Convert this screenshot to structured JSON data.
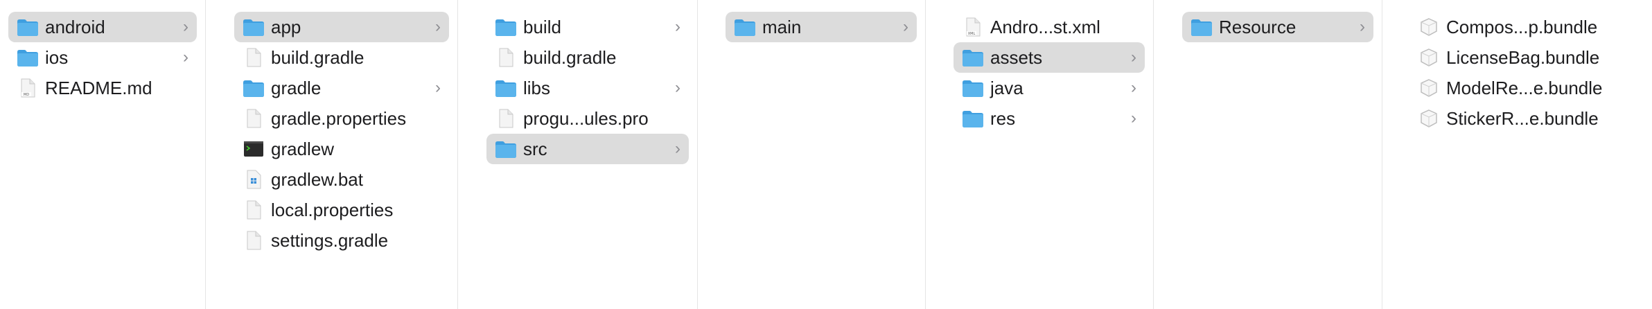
{
  "columns": [
    {
      "items": [
        {
          "name": "android",
          "icon": "folder-icon",
          "chevron": true,
          "selected": true
        },
        {
          "name": "ios",
          "icon": "folder-icon",
          "chevron": true,
          "selected": false
        },
        {
          "name": "README.md",
          "icon": "md-file-icon",
          "chevron": false,
          "selected": false
        }
      ]
    },
    {
      "items": [
        {
          "name": "app",
          "icon": "folder-icon",
          "chevron": true,
          "selected": true
        },
        {
          "name": "build.gradle",
          "icon": "file-icon",
          "chevron": false,
          "selected": false
        },
        {
          "name": "gradle",
          "icon": "folder-icon",
          "chevron": true,
          "selected": false
        },
        {
          "name": "gradle.properties",
          "icon": "file-icon",
          "chevron": false,
          "selected": false
        },
        {
          "name": "gradlew",
          "icon": "terminal-icon",
          "chevron": false,
          "selected": false
        },
        {
          "name": "gradlew.bat",
          "icon": "bat-file-icon",
          "chevron": false,
          "selected": false
        },
        {
          "name": "local.properties",
          "icon": "file-icon",
          "chevron": false,
          "selected": false
        },
        {
          "name": "settings.gradle",
          "icon": "file-icon",
          "chevron": false,
          "selected": false
        }
      ]
    },
    {
      "items": [
        {
          "name": "build",
          "icon": "folder-icon",
          "chevron": true,
          "selected": false
        },
        {
          "name": "build.gradle",
          "icon": "file-icon",
          "chevron": false,
          "selected": false
        },
        {
          "name": "libs",
          "icon": "folder-icon",
          "chevron": true,
          "selected": false
        },
        {
          "name": "progu...ules.pro",
          "icon": "file-icon",
          "chevron": false,
          "selected": false
        },
        {
          "name": "src",
          "icon": "folder-icon",
          "chevron": true,
          "selected": true
        }
      ]
    },
    {
      "items": [
        {
          "name": "main",
          "icon": "folder-icon",
          "chevron": true,
          "selected": true
        }
      ]
    },
    {
      "items": [
        {
          "name": "Andro...st.xml",
          "icon": "xml-file-icon",
          "chevron": false,
          "selected": false
        },
        {
          "name": "assets",
          "icon": "folder-icon",
          "chevron": true,
          "selected": true
        },
        {
          "name": "java",
          "icon": "folder-icon",
          "chevron": true,
          "selected": false
        },
        {
          "name": "res",
          "icon": "folder-icon",
          "chevron": true,
          "selected": false
        }
      ]
    },
    {
      "items": [
        {
          "name": "Resource",
          "icon": "folder-icon",
          "chevron": true,
          "selected": true
        }
      ]
    },
    {
      "items": [
        {
          "name": "Compos...p.bundle",
          "icon": "bundle-icon",
          "chevron": false,
          "selected": false
        },
        {
          "name": "LicenseBag.bundle",
          "icon": "bundle-icon",
          "chevron": false,
          "selected": false
        },
        {
          "name": "ModelRe...e.bundle",
          "icon": "bundle-icon",
          "chevron": false,
          "selected": false
        },
        {
          "name": "StickerR...e.bundle",
          "icon": "bundle-icon",
          "chevron": false,
          "selected": false
        }
      ]
    }
  ],
  "chevron_glyph": "›",
  "colors": {
    "selection": "#dcdcdc",
    "folder": "#5ab4ec",
    "folder_tab": "#3f9fe0",
    "divider": "#e5e5e5",
    "chevron": "#8e8e93"
  }
}
